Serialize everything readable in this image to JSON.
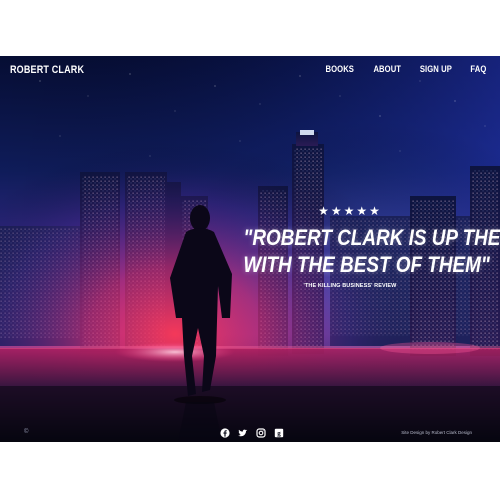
{
  "header": {
    "brand": "ROBERT CLARK",
    "nav": [
      "BOOKS",
      "ABOUT",
      "SIGN UP",
      "FAQ"
    ]
  },
  "hero": {
    "stars": "★★★★★",
    "rating": 5,
    "quote_line1": "\"ROBERT CLARK IS UP THERE",
    "quote_line2": "WITH THE BEST OF THEM\"",
    "source": "'THE KILLING BUSINESS' REVIEW"
  },
  "footer": {
    "copyright": "©",
    "social_icons": [
      "facebook-icon",
      "twitter-icon",
      "instagram-icon",
      "goodreads-icon"
    ],
    "credit": "Site Design by Robert Clark Design"
  },
  "colors": {
    "sky_top": "#06103a",
    "sky_mid": "#1b2a7a",
    "glow_pink": "#ff3d8b",
    "glow_red": "#ff2a3a",
    "ground": "#0b0c1a",
    "text": "#ffffff"
  }
}
